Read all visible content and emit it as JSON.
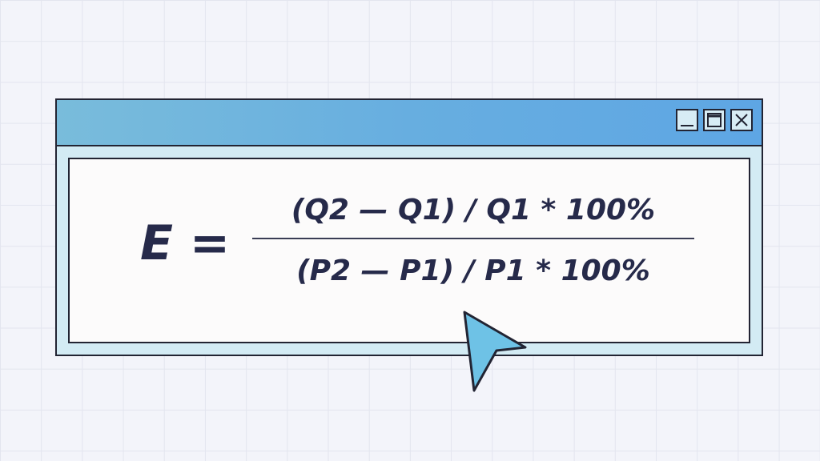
{
  "window": {
    "controls": {
      "minimize_icon": "minimize-icon",
      "maximize_icon": "maximize-icon",
      "close_icon": "close-icon"
    }
  },
  "formula": {
    "lhs": "E =",
    "numerator": "(Q2 — Q1) / Q1 * 100%",
    "denominator": "(P2 — P1) / P1 * 100%"
  },
  "colors": {
    "titlebar_start": "#79bcdb",
    "titlebar_end": "#5ea6e4",
    "window_frame": "#d3ebf4",
    "content_bg": "#fcfbfb",
    "text": "#262a4a",
    "cursor_fill": "#6ec2e6",
    "outline": "#222433"
  },
  "cursor": {
    "icon": "pointer-cursor-icon"
  }
}
